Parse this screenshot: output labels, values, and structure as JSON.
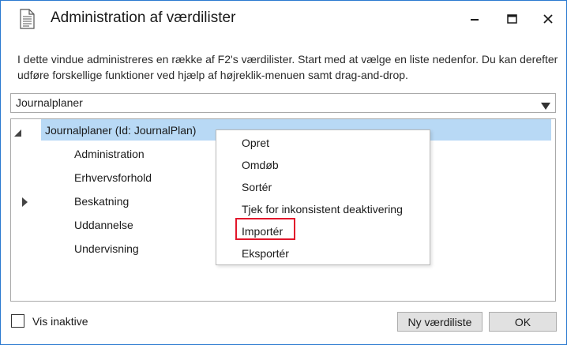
{
  "window": {
    "title": "Administration af værdilister",
    "icon": "document-list-icon",
    "controls": [
      "minimize-icon",
      "maximize-icon",
      "close-icon"
    ]
  },
  "description": "I dette vindue administreres en række af F2's værdilister. Start med at vælge en liste nedenfor. Du kan derefter udføre forskellige funktioner ved hjælp af højreklik-menuen samt drag-and-drop.",
  "dropdown": {
    "selected": "Journalplaner"
  },
  "tree": {
    "root": {
      "label": "Journalplaner (Id: JournalPlan)",
      "expanded": true,
      "selected": true
    },
    "children": [
      {
        "label": "Administration",
        "expandable": false
      },
      {
        "label": "Erhvervsforhold",
        "expandable": false
      },
      {
        "label": "Beskatning",
        "expandable": true
      },
      {
        "label": "Uddannelse",
        "expandable": false
      },
      {
        "label": "Undervisning",
        "expandable": false
      }
    ]
  },
  "context_menu": {
    "items": [
      "Opret",
      "Omdøb",
      "Sortér",
      "Tjek for inkonsistent deaktivering",
      "Importér",
      "Eksportér"
    ],
    "highlighted": "Importér",
    "highlight_color": "#e2162b"
  },
  "footer": {
    "checkbox_label": "Vis inaktive",
    "checkbox_checked": false,
    "new_button": "Ny værdiliste",
    "ok_button": "OK"
  },
  "colors": {
    "window_border": "#2b79d0",
    "selection": "#b8d9f5"
  }
}
